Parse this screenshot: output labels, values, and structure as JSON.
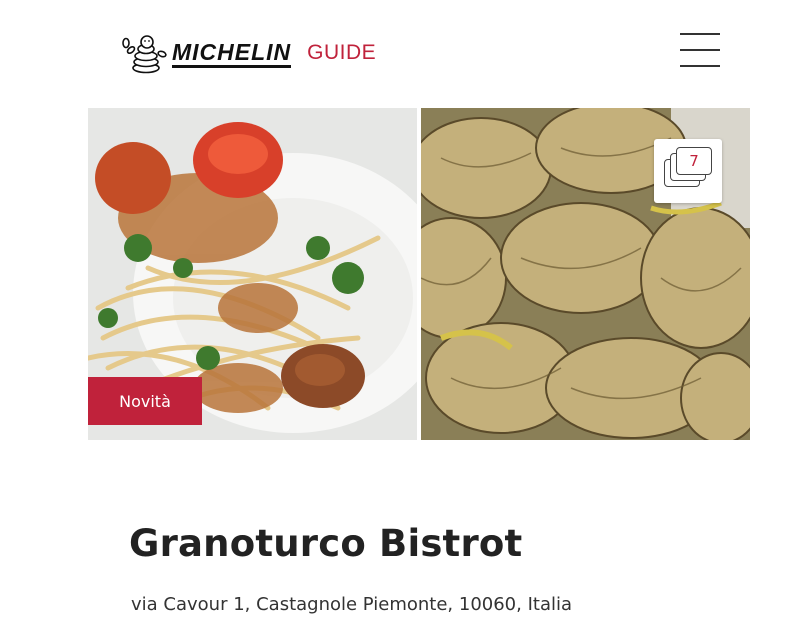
{
  "header": {
    "brand": "MICHELIN",
    "guide": "GUIDE",
    "logo_icon": "bibendum-icon",
    "menu_icon": "hamburger-menu-icon"
  },
  "gallery": {
    "photos": [
      {
        "name": "pasta-photo",
        "alt": "spaghetti with breadcrumbs and tomatoes"
      },
      {
        "name": "truffle-photo",
        "alt": "sliced truffles"
      }
    ],
    "badge": "Novità",
    "photo_count": "7",
    "photo_count_icon": "photo-stack-icon"
  },
  "restaurant": {
    "name": "Granoturco Bistrot",
    "address": "via Cavour 1, Castagnole Piemonte, 10060, Italia"
  },
  "colors": {
    "brand_red": "#c0223b",
    "text_dark": "#222222"
  }
}
